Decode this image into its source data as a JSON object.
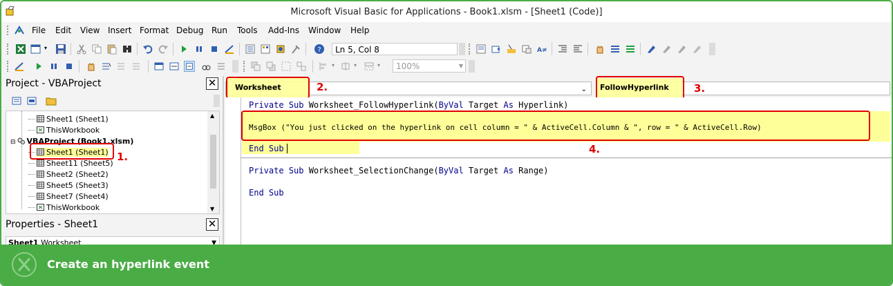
{
  "window": {
    "title": "Microsoft Visual Basic for Applications - Book1.xlsm - [Sheet1 (Code)]"
  },
  "menu": [
    "File",
    "Edit",
    "View",
    "Insert",
    "Format",
    "Debug",
    "Run",
    "Tools",
    "Add-Ins",
    "Window",
    "Help"
  ],
  "toolbar": {
    "cursor_position": "Ln 5, Col 8",
    "zoom": "100%"
  },
  "project_explorer": {
    "title": "Project - VBAProject",
    "close": "✕",
    "items": [
      {
        "label": "Sheet1 (Sheet1)",
        "icon": "worksheet-icon"
      },
      {
        "label": "ThisWorkbook",
        "icon": "workbook-icon"
      },
      {
        "label": "VBAProject (Book1.xlsm)",
        "icon": "project-icon",
        "bold": true
      },
      {
        "label": "Sheet1 (Sheet1)",
        "icon": "worksheet-icon",
        "selected": true
      },
      {
        "label": "Sheet11 (Sheet5)",
        "icon": "worksheet-icon"
      },
      {
        "label": "Sheet2 (Sheet2)",
        "icon": "worksheet-icon"
      },
      {
        "label": "Sheet5 (Sheet3)",
        "icon": "worksheet-icon"
      },
      {
        "label": "Sheet7 (Sheet4)",
        "icon": "worksheet-icon"
      },
      {
        "label": "ThisWorkbook",
        "icon": "workbook-icon"
      }
    ]
  },
  "properties": {
    "title": "Properties - Sheet1",
    "close": "✕",
    "object_name": "Sheet1",
    "object_type": "Worksheet"
  },
  "editor": {
    "object_dropdown": "Worksheet",
    "procedure_dropdown": "FollowHyperlink",
    "code": {
      "line1": {
        "kw1": "Private Sub",
        "rest1": " Worksheet_FollowHyperlink(",
        "kw2": "ByVal",
        "rest2": " Target ",
        "kw3": "As",
        "rest3": " Hyperlink)"
      },
      "line2": "MsgBox (\"You just clicked on the hyperlink on cell column = \" & ActiveCell.Column & \", row = \" & ActiveCell.Row)",
      "line3": {
        "kw": "End Sub"
      },
      "line4": {
        "kw1": "Private Sub",
        "rest1": " Worksheet_SelectionChange(",
        "kw2": "ByVal",
        "rest2": " Target ",
        "kw3": "As",
        "rest3": " Range)"
      },
      "line5": {
        "kw": "End Sub"
      }
    }
  },
  "annotations": [
    "1.",
    "2.",
    "3.",
    "4."
  ],
  "footer": {
    "caption": "Create an hyperlink event"
  },
  "colors": {
    "brand_green": "#4aac45",
    "annotation_red": "#e00000",
    "highlight_yellow": "#ffff99",
    "keyword_blue": "#00008b"
  }
}
